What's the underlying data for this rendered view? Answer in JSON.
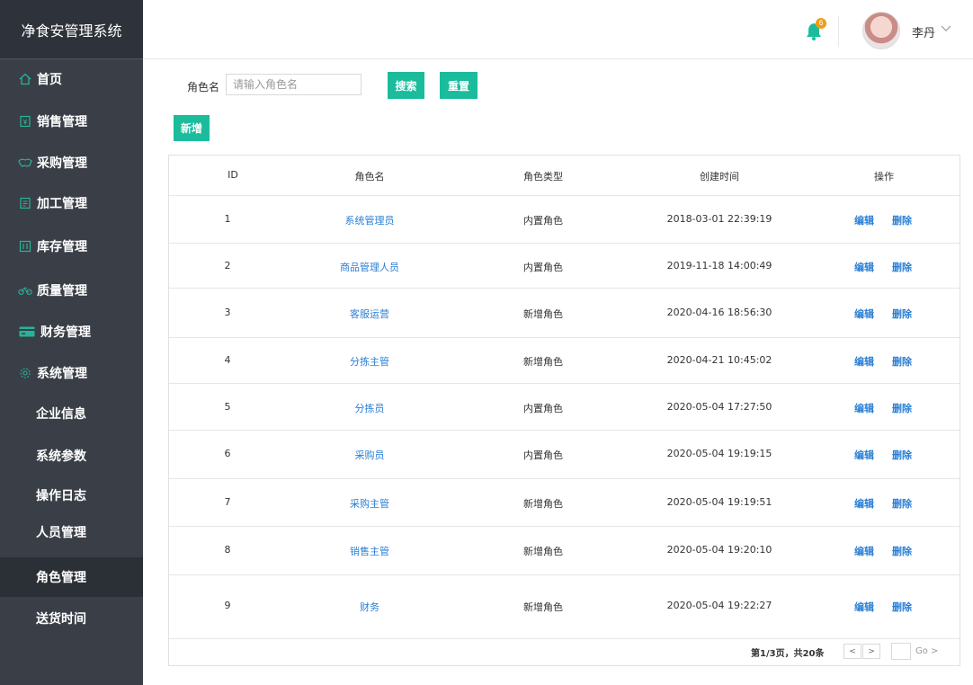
{
  "app": {
    "title": "净食安管理系统"
  },
  "sidebar": {
    "items": [
      {
        "label": "首页",
        "icon": "home-icon"
      },
      {
        "label": "销售管理",
        "icon": "sales-icon"
      },
      {
        "label": "采购管理",
        "icon": "handshake-icon"
      },
      {
        "label": "加工管理",
        "icon": "process-icon"
      },
      {
        "label": "库存管理",
        "icon": "inventory-icon"
      },
      {
        "label": "质量管理",
        "icon": "bike-icon"
      },
      {
        "label": "财务管理",
        "icon": "card-icon"
      },
      {
        "label": "系统管理",
        "icon": "gear-icon"
      }
    ],
    "sub_items": [
      {
        "label": "企业信息"
      },
      {
        "label": "系统参数"
      },
      {
        "label": "操作日志"
      },
      {
        "label": "人员管理"
      },
      {
        "label": "角色管理",
        "active": true
      },
      {
        "label": "送货时间"
      }
    ]
  },
  "header": {
    "notification_count": "6",
    "user_name": "李丹"
  },
  "filter": {
    "label": "角色名",
    "placeholder": "请输入角色名",
    "search_label": "搜索",
    "reset_label": "重置",
    "add_label": "新增"
  },
  "table": {
    "columns": [
      "ID",
      "角色名",
      "角色类型",
      "创建时间",
      "操作"
    ],
    "rows": [
      {
        "id": "1",
        "name": "系统管理员",
        "type": "内置角色",
        "created": "2018-03-01 22:39:19",
        "edit": "编辑",
        "delete": "删除"
      },
      {
        "id": "2",
        "name": "商品管理人员",
        "type": "内置角色",
        "created": "2019-11-18 14:00:49",
        "edit": "编辑",
        "delete": "删除"
      },
      {
        "id": "3",
        "name": "客服运营",
        "type": "新增角色",
        "created": "2020-04-16 18:56:30",
        "edit": "编辑",
        "delete": "删除"
      },
      {
        "id": "4",
        "name": "分拣主管",
        "type": "新增角色",
        "created": "2020-04-21 10:45:02",
        "edit": "编辑",
        "delete": "删除"
      },
      {
        "id": "5",
        "name": "分拣员",
        "type": "内置角色",
        "created": "2020-05-04 17:27:50",
        "edit": "编辑",
        "delete": "删除"
      },
      {
        "id": "6",
        "name": "采购员",
        "type": "内置角色",
        "created": "2020-05-04 19:19:15",
        "edit": "编辑",
        "delete": "删除"
      },
      {
        "id": "7",
        "name": "采购主管",
        "type": "新增角色",
        "created": "2020-05-04 19:19:51",
        "edit": "编辑",
        "delete": "删除"
      },
      {
        "id": "8",
        "name": "销售主管",
        "type": "新增角色",
        "created": "2020-05-04 19:20:10",
        "edit": "编辑",
        "delete": "删除"
      },
      {
        "id": "9",
        "name": "财务",
        "type": "新增角色",
        "created": "2020-05-04 19:22:27",
        "edit": "编辑",
        "delete": "删除"
      }
    ]
  },
  "pagination": {
    "summary": "第1/3页，共20条",
    "prev": "<",
    "next": ">",
    "go": "Go >"
  },
  "colors": {
    "accent": "#1abc9c",
    "sidebar_bg": "#3a3f47",
    "link": "#2a7fd4",
    "badge": "#f39c12"
  }
}
